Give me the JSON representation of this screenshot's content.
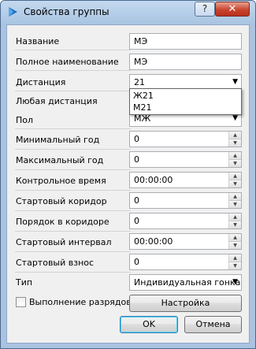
{
  "window": {
    "title": "Свойства группы",
    "help_label": "?",
    "close_label": "✕"
  },
  "fields": {
    "name": {
      "label": "Название",
      "value": "МЭ"
    },
    "full_name": {
      "label": "Полное наименование",
      "value": "МЭ"
    },
    "distance": {
      "label": "Дистанция",
      "value": "21",
      "options": [
        "Ж21",
        "М21"
      ]
    },
    "any_distance": {
      "label": "Любая дистанция"
    },
    "sex": {
      "label": "Пол",
      "value": "МЖ"
    },
    "min_year": {
      "label": "Минимальный год",
      "value": "0"
    },
    "max_year": {
      "label": "Максимальный год",
      "value": "0"
    },
    "control_time": {
      "label": "Контрольное время",
      "value": "00:00:00"
    },
    "start_corridor": {
      "label": "Стартовый коридор",
      "value": "0"
    },
    "corridor_order": {
      "label": "Порядок в коридоре",
      "value": "0"
    },
    "start_interval": {
      "label": "Стартовый интервал",
      "value": "00:00:00"
    },
    "start_fee": {
      "label": "Стартовый взнос",
      "value": "0"
    },
    "type": {
      "label": "Тип",
      "value": "Индивидуальная гонка"
    }
  },
  "ranks_checkbox": {
    "label": "Выполнение разрядов",
    "checked": false
  },
  "buttons": {
    "settings": "Настройка",
    "ok": "OK",
    "cancel": "Отмена"
  },
  "icons": {
    "app": "app-icon",
    "help": "help-icon",
    "close": "close-icon"
  },
  "colors": {
    "title_bar": "#a9c3e0",
    "close_button": "#c8452f",
    "panel": "#f0f0f0"
  }
}
